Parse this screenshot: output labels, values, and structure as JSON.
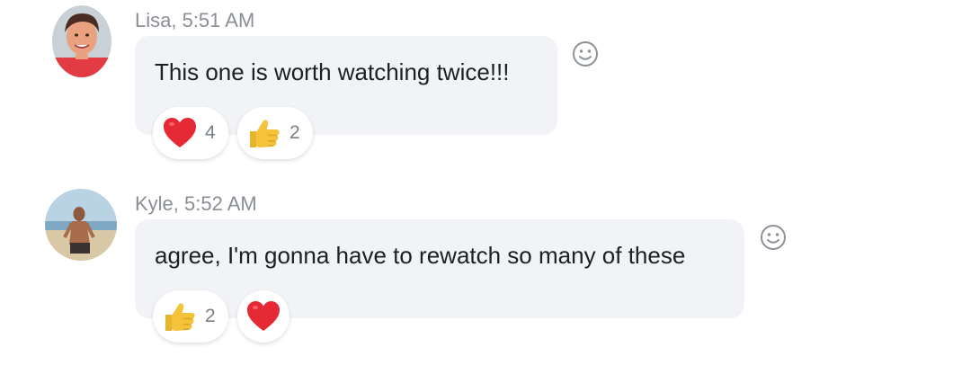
{
  "messages": [
    {
      "author": "Lisa",
      "time": "5:51 AM",
      "meta": "Lisa, 5:51 AM",
      "text": "This one is worth watching twice!!!",
      "reactions": [
        {
          "icon": "heart-emoji",
          "count": "4"
        },
        {
          "icon": "thumbs-up-emoji",
          "count": "2"
        }
      ]
    },
    {
      "author": "Kyle",
      "time": "5:52 AM",
      "meta": "Kyle, 5:52 AM",
      "text": "agree, I'm gonna have to rewatch so many of these",
      "reactions": [
        {
          "icon": "thumbs-up-emoji",
          "count": "2"
        },
        {
          "icon": "heart-emoji",
          "count": ""
        }
      ]
    }
  ],
  "icons": {
    "add_reaction": "smiley-icon",
    "heart": "heart-emoji",
    "thumbs_up": "thumbs-up-emoji"
  },
  "colors": {
    "bubble_bg": "#f1f3f6",
    "meta_text": "#8a8f96",
    "heart": "#e62a35",
    "thumb": "#f4c33a"
  }
}
